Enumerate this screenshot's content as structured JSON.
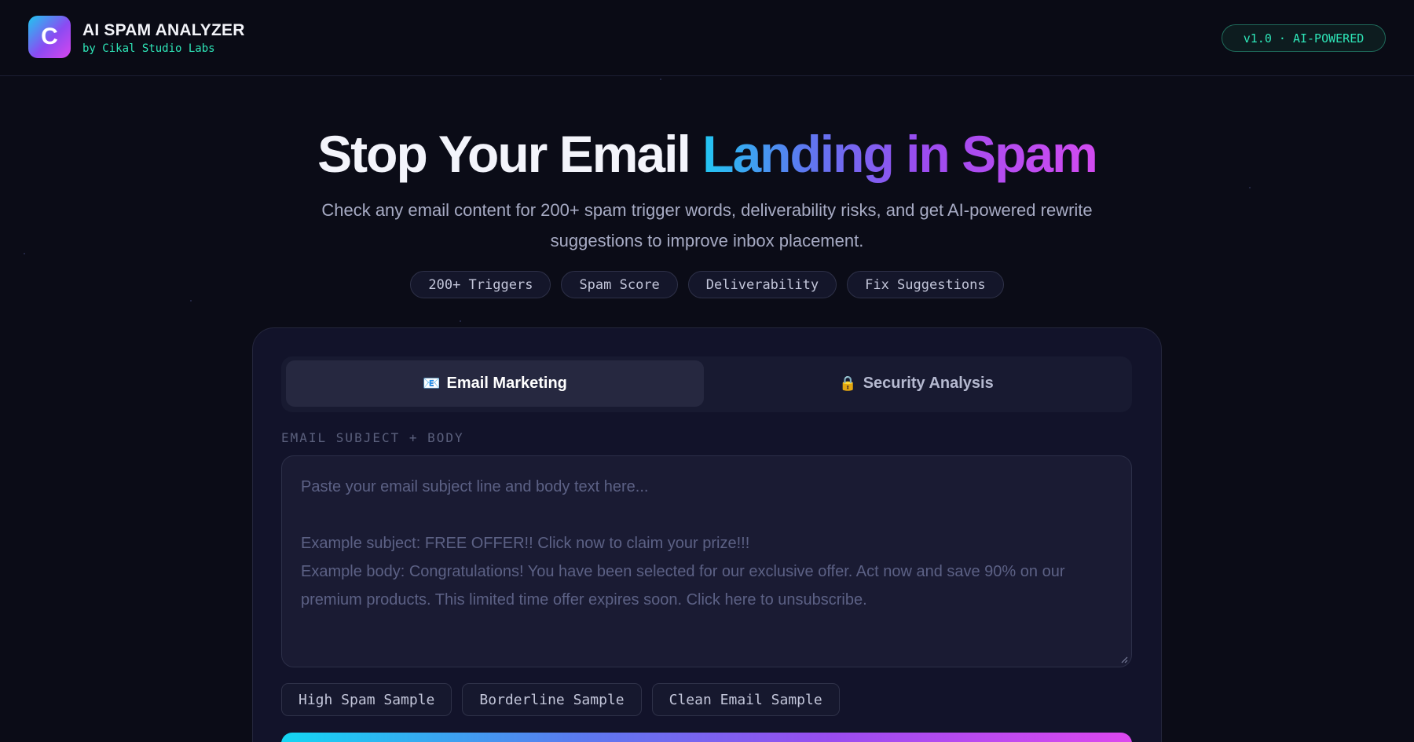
{
  "header": {
    "logo_letter": "C",
    "title": "AI SPAM ANALYZER",
    "subtitle": "by Cikal Studio Labs",
    "version_badge": "v1.0 · AI-POWERED"
  },
  "hero": {
    "title_plain": "Stop Your Email ",
    "title_gradient": "Landing in Spam",
    "description": "Check any email content for 200+ spam trigger words, deliverability risks, and get AI-powered rewrite suggestions to improve inbox placement.",
    "chips": [
      "200+ Triggers",
      "Spam Score",
      "Deliverability",
      "Fix Suggestions"
    ]
  },
  "tabs": [
    {
      "icon": "📧",
      "label": "Email Marketing",
      "active": true
    },
    {
      "icon": "🔒",
      "label": "Security Analysis",
      "active": false
    }
  ],
  "input": {
    "label": "EMAIL SUBJECT + BODY",
    "value": "",
    "placeholder": "Paste your email subject line and body text here...\n\nExample subject: FREE OFFER!! Click now to claim your prize!!!\nExample body: Congratulations! You have been selected for our exclusive offer. Act now and save 90% on our premium products. This limited time offer expires soon. Click here to unsubscribe."
  },
  "samples": [
    "High Spam Sample",
    "Borderline Sample",
    "Clean Email Sample"
  ],
  "colors": {
    "background": "#0b0c17",
    "accent_teal": "#2ee6b8",
    "gradient_start": "#22c7f2",
    "gradient_end": "#d24bf0"
  }
}
